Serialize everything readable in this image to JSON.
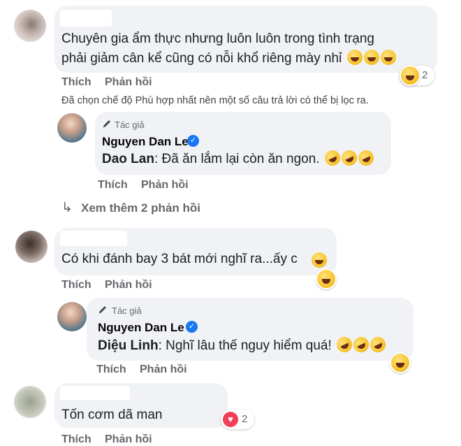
{
  "comments": [
    {
      "text_line1": "Chuyên gia ẩm thực nhưng luôn luôn trong tình trạng",
      "text_line2": "phải giảm cân kể cũng có nỗi khổ riêng mày nhỉ",
      "reaction_count": "2",
      "like_label": "Thích",
      "reply_label": "Phản hồi"
    },
    {
      "text": "Có khi đánh bay 3 bát mới nghĩ ra...ấy c",
      "like_label": "Thích",
      "reply_label": "Phản hồi"
    },
    {
      "text": "Tốn cơm dã man",
      "reaction_count": "2",
      "like_label": "Thích",
      "reply_label": "Phản hồi"
    }
  ],
  "filter_notice": "Đã chọn chế độ Phù hợp nhất nên một số câu trả lời có thể bị lọc ra.",
  "replies": [
    {
      "author_tag": "Tác giả",
      "author_name": "Nguyen Dan Le",
      "mention": "Dao Lan",
      "text": ": Đã ăn lắm lại còn ăn ngon.",
      "like_label": "Thích",
      "reply_label": "Phản hồi"
    },
    {
      "author_tag": "Tác giả",
      "author_name": "Nguyen Dan Le",
      "mention": "Diệu Linh",
      "text": ": Nghĩ lâu thế nguy hiểm quá!",
      "like_label": "Thích",
      "reply_label": "Phản hồi"
    }
  ],
  "view_more": "Xem thêm 2 phản hồi",
  "colors": {
    "bubble": "#f0f2f5",
    "verified": "#1877f2",
    "action_text": "#65676b",
    "love": "#f33e58"
  },
  "icons": [
    "pencil-icon",
    "verified-check-icon",
    "reply-arrow-icon",
    "laughing-emoji",
    "haha-reaction-icon",
    "love-reaction-icon"
  ]
}
